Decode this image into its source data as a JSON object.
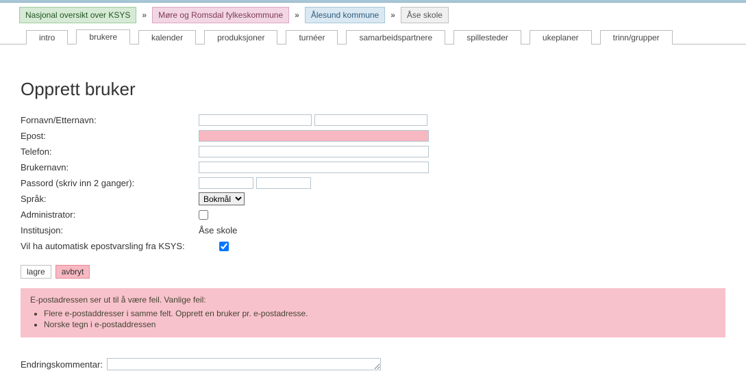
{
  "breadcrumbs": {
    "sep": "»",
    "items": [
      {
        "label": "Nasjonal oversikt over KSYS",
        "cls": "crumb-green"
      },
      {
        "label": "Møre og Romsdal fylkeskommune",
        "cls": "crumb-red"
      },
      {
        "label": "Ålesund kommune",
        "cls": "crumb-blue"
      },
      {
        "label": "Åse skole",
        "cls": "crumb-gray"
      }
    ]
  },
  "tabs": [
    {
      "label": "intro",
      "active": false
    },
    {
      "label": "brukere",
      "active": true
    },
    {
      "label": "kalender",
      "active": false
    },
    {
      "label": "produksjoner",
      "active": false
    },
    {
      "label": "turnéer",
      "active": false
    },
    {
      "label": "samarbeidspartnere",
      "active": false
    },
    {
      "label": "spillesteder",
      "active": false
    },
    {
      "label": "ukeplaner",
      "active": false
    },
    {
      "label": "trinn/grupper",
      "active": false
    }
  ],
  "page": {
    "title": "Opprett bruker"
  },
  "form": {
    "fornavn_label": "Fornavn/Etternavn:",
    "fornavn_value": "",
    "etternavn_value": "",
    "epost_label": "Epost:",
    "epost_value": "",
    "telefon_label": "Telefon:",
    "telefon_value": "",
    "brukernavn_label": "Brukernavn:",
    "brukernavn_value": "",
    "passord_label": "Passord (skriv inn 2 ganger):",
    "pass1_value": "",
    "pass2_value": "",
    "sprak_label": "Språk:",
    "sprak_selected": "Bokmål",
    "admin_label": "Administrator:",
    "admin_checked": false,
    "institusjon_label": "Institusjon:",
    "institusjon_value": "Åse skole",
    "varsling_label": "Vil ha automatisk epostvarsling fra KSYS:",
    "varsling_checked": true
  },
  "buttons": {
    "save": "lagre",
    "cancel": "avbryt"
  },
  "error": {
    "heading": "E-postadressen ser ut til å være feil. Vanlige feil:",
    "items": [
      "Flere e-postaddresser i samme felt. Opprett en bruker pr. e-postadresse.",
      "Norske tegn i e-postaddressen"
    ]
  },
  "comment": {
    "label": "Endringskommentar:",
    "value": ""
  }
}
